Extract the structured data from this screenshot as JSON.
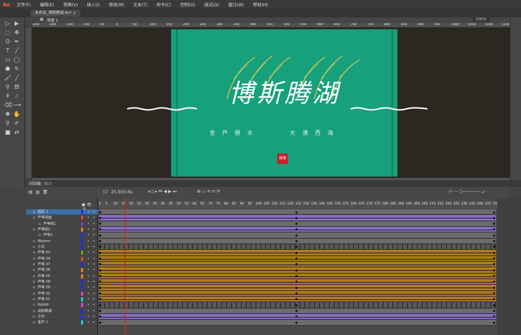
{
  "app": {
    "logo": "An"
  },
  "menu": [
    "文件(F)",
    "编辑(E)",
    "视图(V)",
    "插入(I)",
    "修改(M)",
    "文本(T)",
    "命令(C)",
    "控制(O)",
    "调试(D)",
    "窗口(W)",
    "帮助(H)"
  ],
  "document_tab": {
    "title": "未命名_博斯腾湖.fla*",
    "close": "×"
  },
  "editbar": {
    "scene": "场景 1",
    "zoom": "100%"
  },
  "ruler_ticks": [
    "-250",
    "-200",
    "-150",
    "-100",
    "-50",
    "0",
    "50",
    "100",
    "150",
    "200",
    "250",
    "300",
    "350",
    "400",
    "450",
    "500",
    "550",
    "600",
    "650",
    "700",
    "750",
    "800",
    "850",
    "900",
    "950",
    "1000",
    "1050",
    "1100",
    "1150"
  ],
  "stage": {
    "title": "博斯腾湖",
    "subtitle_left": "金芦碧水",
    "subtitle_right": "大漠西海",
    "seal": "博湖",
    "background": "#16a07c"
  },
  "timeline": {
    "tabs": [
      "时间轴",
      "输出"
    ],
    "current_frame": "17",
    "fps": "25.00",
    "fps_unit": "fps",
    "time": "0.6s",
    "frame_labels": [
      "1",
      "5",
      "10",
      "15",
      "20",
      "25",
      "30",
      "35",
      "40",
      "45",
      "50",
      "55",
      "60",
      "65",
      "70",
      "75",
      "80",
      "85",
      "90",
      "95",
      "100",
      "105",
      "110",
      "115",
      "120",
      "125",
      "130",
      "135",
      "140",
      "145",
      "150",
      "155",
      "160",
      "165",
      "170",
      "175",
      "180",
      "185",
      "190",
      "195",
      "200",
      "205",
      "210",
      "215",
      "220",
      "225",
      "230",
      "235",
      "240",
      "245",
      "250"
    ],
    "playhead_frame": 17,
    "total_frames": 250,
    "layers": [
      {
        "name": "图层 1",
        "color": "#1a2bff",
        "type": "gray",
        "selected": true
      },
      {
        "name": "芦苇动画",
        "color": "#e04040",
        "type": "purple"
      },
      {
        "name": "芦苇组1",
        "color": "#8a3ad0",
        "type": "gray"
      },
      {
        "name": "芦苇组2",
        "color": "#f07a1a",
        "type": "purple"
      },
      {
        "name": "芦苇2",
        "color": "#1a2bff",
        "type": "gray"
      },
      {
        "name": "Meshm",
        "color": "#1a2bff",
        "type": "gray"
      },
      {
        "name": "小鸟",
        "color": "#1a2bff",
        "type": "keys"
      },
      {
        "name": "芦苇 03",
        "color": "#6a9a1a",
        "type": "orange"
      },
      {
        "name": "芦苇 04",
        "color": "#e04040",
        "type": "orange"
      },
      {
        "name": "芦苇 07",
        "color": "#1a2bff",
        "type": "orange"
      },
      {
        "name": "芦苇 06",
        "color": "#f07a1a",
        "type": "orange"
      },
      {
        "name": "芦苇 05",
        "color": "#f07a1a",
        "type": "orange"
      },
      {
        "name": "芦苇 08",
        "color": "#1a2bff",
        "type": "orange"
      },
      {
        "name": "芦苇 09",
        "color": "#1a2bff",
        "type": "orange"
      },
      {
        "name": "芦苇 02",
        "color": "#e040d0",
        "type": "orange"
      },
      {
        "name": "芦苇 01",
        "color": "#1ad0d0",
        "type": "orange"
      },
      {
        "name": "Rabbit",
        "color": "#e040d0",
        "type": "keys"
      },
      {
        "name": "纳斯腾湖",
        "color": "#1a2bff",
        "type": "gray"
      },
      {
        "name": "文字",
        "color": "#1a2bff",
        "type": "purple"
      },
      {
        "name": "金芦 1",
        "color": "#1ad0d0",
        "type": "gray"
      }
    ]
  }
}
